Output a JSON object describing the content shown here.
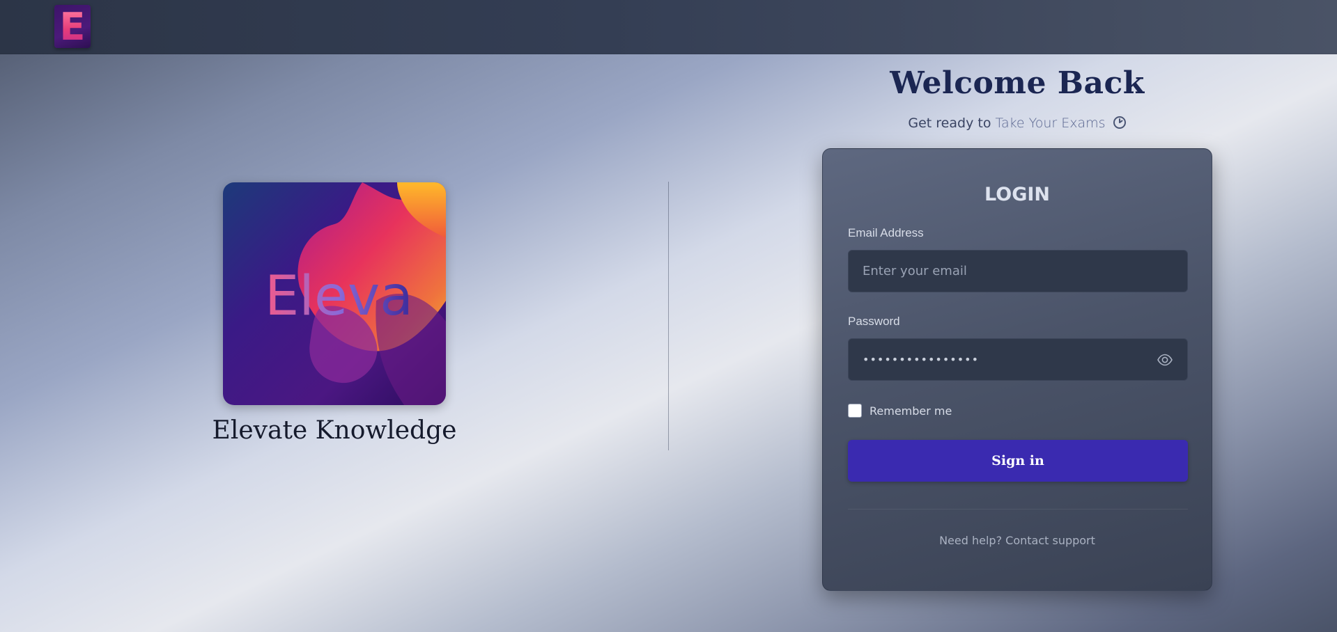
{
  "navbar": {
    "logo_letter": "E",
    "logo_icon": "app-logo-icon"
  },
  "brand": {
    "image_text": "Eleva",
    "caption": "Elevate Knowledge"
  },
  "welcome": {
    "title": "Welcome Back",
    "subtitle_prefix": "Get ready to",
    "subtitle_highlight": "Take Your Exams",
    "subtitle_icon": "clock-icon"
  },
  "login": {
    "heading": "LOGIN",
    "email_label": "Email Address",
    "email_placeholder": "Enter your email",
    "email_value": "",
    "password_label": "Password",
    "password_value": "passwordpassword",
    "password_toggle_icon": "eye-icon",
    "remember_label": "Remember me",
    "remember_checked": false,
    "signin_label": "Sign in",
    "help_text": "Need help? Contact support"
  },
  "colors": {
    "primary_button": "#3a2ab0",
    "title": "#1b2652",
    "card_bg": "#4b5469",
    "input_bg": "#2f384a"
  }
}
